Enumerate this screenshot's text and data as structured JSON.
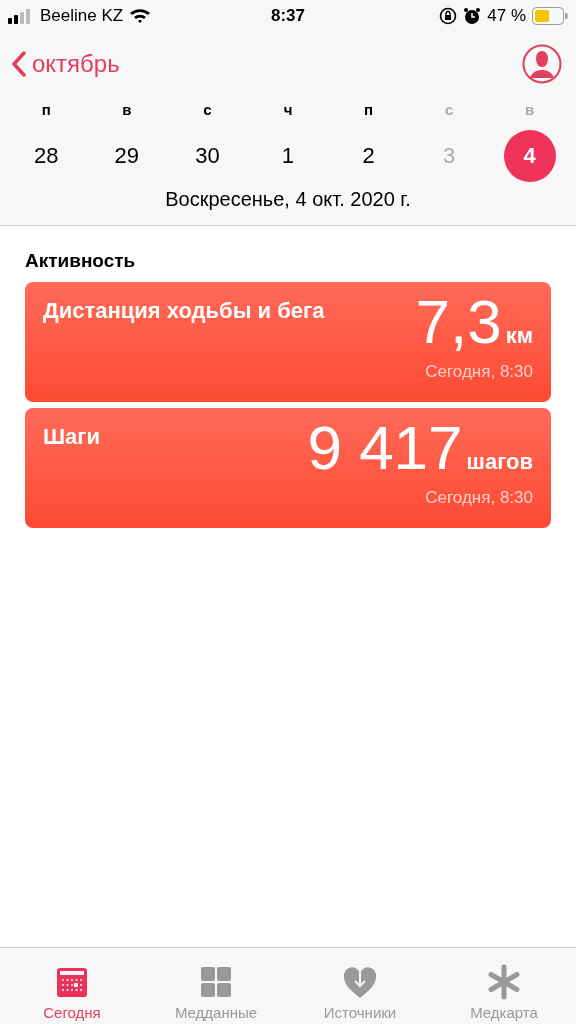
{
  "status_bar": {
    "carrier": "Beeline KZ",
    "time": "8:37",
    "battery": "47 %"
  },
  "nav": {
    "back": "октябрь"
  },
  "week": [
    {
      "weekday": "п",
      "day": "28",
      "dimmed": false,
      "selected": false
    },
    {
      "weekday": "в",
      "day": "29",
      "dimmed": false,
      "selected": false
    },
    {
      "weekday": "с",
      "day": "30",
      "dimmed": false,
      "selected": false
    },
    {
      "weekday": "ч",
      "day": "1",
      "dimmed": false,
      "selected": false
    },
    {
      "weekday": "п",
      "day": "2",
      "dimmed": false,
      "selected": false
    },
    {
      "weekday": "с",
      "day": "3",
      "dimmed": true,
      "selected": false
    },
    {
      "weekday": "в",
      "day": "4",
      "dimmed": true,
      "selected": true
    }
  ],
  "date": "Воскресенье, 4 окт. 2020 г.",
  "section": "Активность",
  "cards": [
    {
      "title": "Дистанция ходьбы и бега",
      "value": "7,3",
      "unit": "км",
      "time": "Сегодня, 8:30"
    },
    {
      "title": "Шаги",
      "value": "9 417",
      "unit": "шагов",
      "time": "Сегодня, 8:30"
    }
  ],
  "tabs": [
    {
      "label": "Сегодня",
      "selected": true
    },
    {
      "label": "Медданные",
      "selected": false
    },
    {
      "label": "Источники",
      "selected": false
    },
    {
      "label": "Медкарта",
      "selected": false
    }
  ]
}
